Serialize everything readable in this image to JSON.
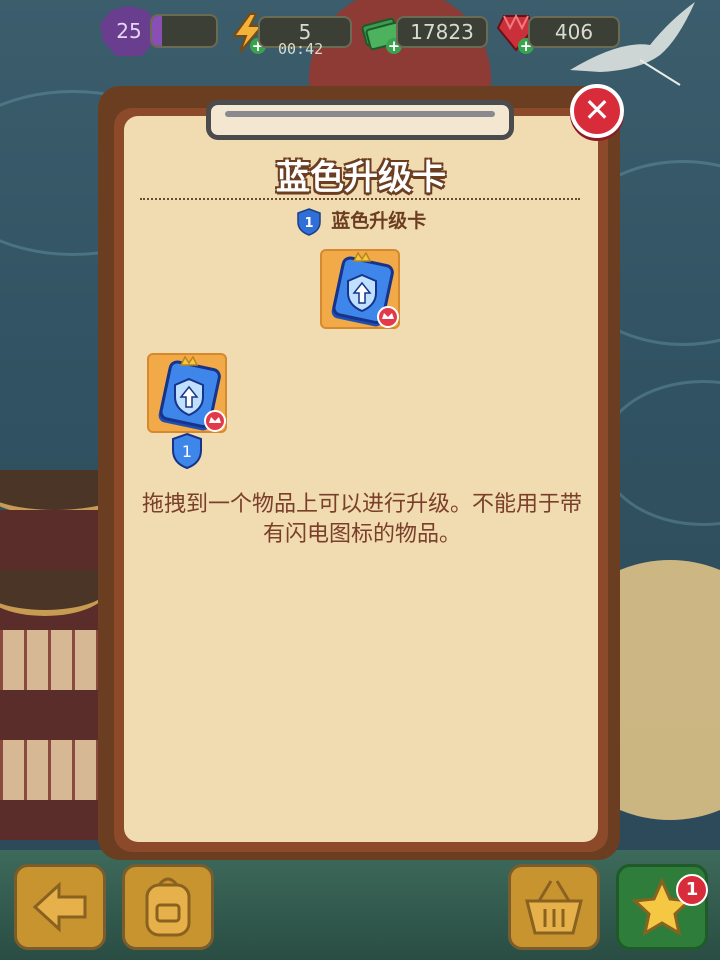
{
  "hud": {
    "level": "25",
    "xp_progress": 0.15,
    "energy": "5",
    "energy_timer": "00:42",
    "cash": "17823",
    "gems": "406"
  },
  "dialog": {
    "title": "蓝色升级卡",
    "item_level": "1",
    "item_name": "蓝色升级卡",
    "card_level": "1",
    "description": "拖拽到一个物品上可以进行升级。不能用于带有闪电图标的物品。"
  },
  "toolbar": {
    "notification_count": "1"
  },
  "icons": {
    "close": "close-icon",
    "energy": "lightning-icon",
    "cash": "cash-stack-icon",
    "gems": "red-gem-icon",
    "card": "blue-upgrade-card-icon",
    "back": "back-arrow-icon",
    "bag": "backpack-icon",
    "shop": "basket-icon",
    "star": "star-icon"
  },
  "colors": {
    "paper": "#f1dbb0",
    "frame": "#6b3e22",
    "close_red": "#d92c3a",
    "card_blue": "#2f6fd6",
    "text_brown": "#7a3f2a"
  }
}
